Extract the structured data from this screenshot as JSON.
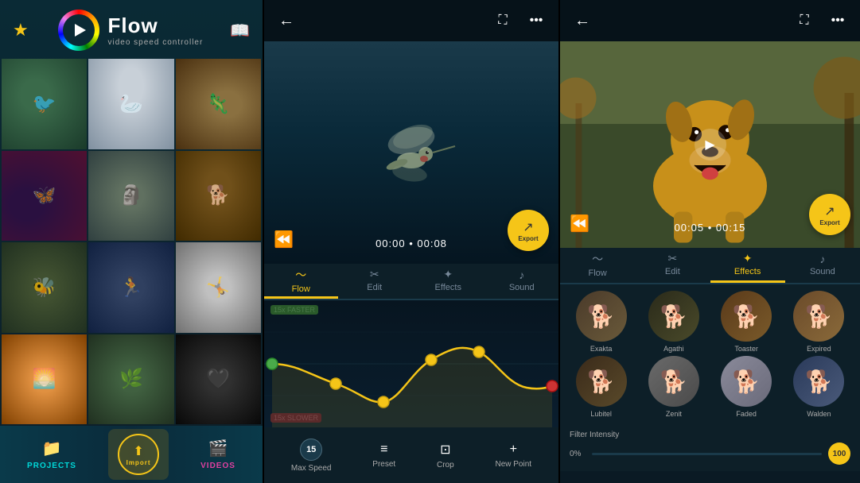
{
  "app": {
    "name": "Flow",
    "subtitle": "video speed controller"
  },
  "library": {
    "star_label": "★",
    "thumbs": [
      {
        "id": "t1",
        "label": "hummingbird"
      },
      {
        "id": "t2",
        "label": "bird white"
      },
      {
        "id": "t3",
        "label": "lizard"
      },
      {
        "id": "t4",
        "label": "butterfly"
      },
      {
        "id": "t5",
        "label": "statue"
      },
      {
        "id": "t6",
        "label": "dog cap"
      },
      {
        "id": "t7",
        "label": "bee"
      },
      {
        "id": "t8",
        "label": "runner"
      },
      {
        "id": "t9",
        "label": "jump bw"
      },
      {
        "id": "t10",
        "label": "silhouette"
      },
      {
        "id": "t11",
        "label": "trail"
      },
      {
        "id": "t12",
        "label": "dark hair"
      }
    ],
    "toolbar": {
      "projects_label": "PROJECTS",
      "import_label": "Import",
      "videos_label": "VIDEOS"
    }
  },
  "flow_editor": {
    "back_button": "←",
    "time_display": "00:00 • 00:08",
    "export_label": "Export",
    "tabs": [
      {
        "id": "flow",
        "label": "Flow",
        "icon": "〜",
        "active": true
      },
      {
        "id": "edit",
        "label": "Edit",
        "icon": "✂",
        "active": false
      },
      {
        "id": "effects",
        "label": "Effects",
        "icon": "✦",
        "active": false
      },
      {
        "id": "sound",
        "label": "Sound",
        "icon": "♪",
        "active": false
      }
    ],
    "curve": {
      "faster_label": "15x FASTER",
      "slower_label": "15x SLOWER"
    },
    "controls": [
      {
        "id": "max_speed",
        "label": "Max Speed",
        "value": "15",
        "icon": "🔄"
      },
      {
        "id": "preset",
        "label": "Preset",
        "icon": "≡"
      },
      {
        "id": "crop",
        "label": "Crop",
        "icon": "⊡"
      },
      {
        "id": "new_point",
        "label": "New Point",
        "icon": "+"
      }
    ]
  },
  "effects_editor": {
    "back_button": "←",
    "time_display": "00:05 • 00:15",
    "export_label": "Export",
    "tabs": [
      {
        "id": "flow",
        "label": "Flow",
        "icon": "〜",
        "active": false
      },
      {
        "id": "edit",
        "label": "Edit",
        "icon": "✂",
        "active": false
      },
      {
        "id": "effects",
        "label": "Effects",
        "icon": "✦",
        "active": true
      },
      {
        "id": "sound",
        "label": "Sound",
        "icon": "♪",
        "active": false
      }
    ],
    "filters": [
      {
        "id": "exakta",
        "label": "Exakta",
        "class": "f-exakta"
      },
      {
        "id": "agathi",
        "label": "Agathi",
        "class": "f-agathi"
      },
      {
        "id": "toaster",
        "label": "Toaster",
        "class": "f-toaster"
      },
      {
        "id": "expired",
        "label": "Expired",
        "class": "f-expired"
      },
      {
        "id": "lubitel",
        "label": "Lubitel",
        "class": "f-lubitel"
      },
      {
        "id": "zenit",
        "label": "Zenit",
        "class": "f-zenit"
      },
      {
        "id": "faded",
        "label": "Faded",
        "class": "f-faded"
      },
      {
        "id": "walden",
        "label": "Walden",
        "class": "f-walden"
      }
    ],
    "intensity": {
      "label": "Filter Intensity",
      "value": "0%",
      "max_value": "100"
    }
  }
}
